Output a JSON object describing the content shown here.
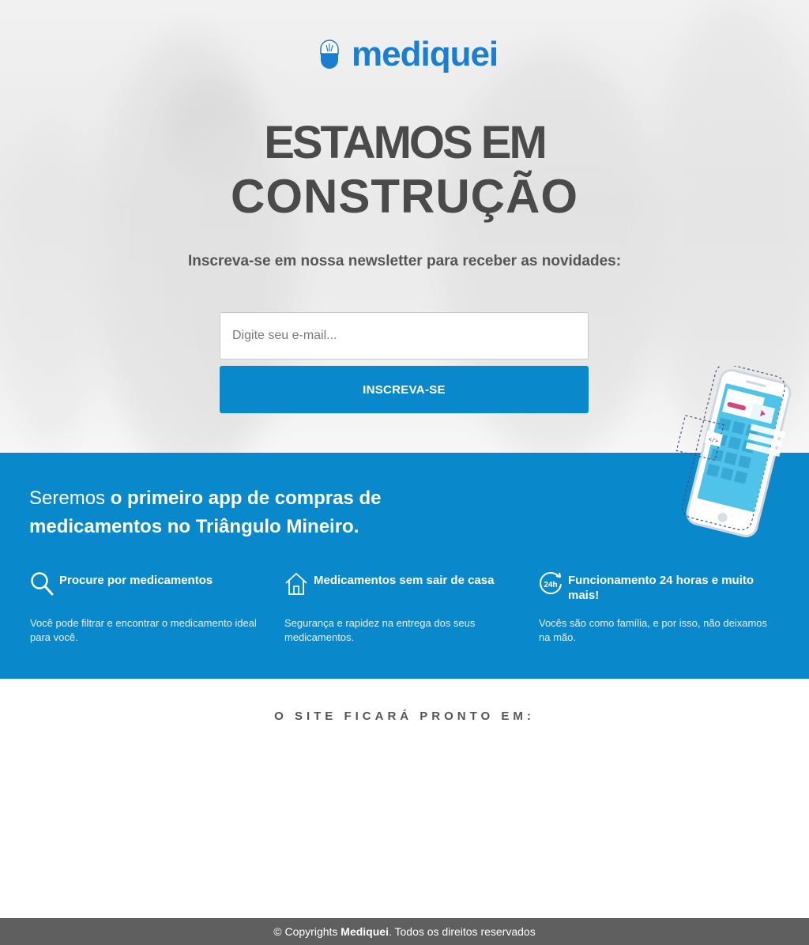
{
  "brand": {
    "name": "mediquei",
    "color": "#1a7fd1"
  },
  "hero": {
    "title_line1": "ESTAMOS EM",
    "title_line2": "CONSTRUÇÃO",
    "subtitle": "Inscreva-se em nossa newsletter para receber as novidades:",
    "email_placeholder": "Digite seu e-mail...",
    "subscribe_label": "INSCREVA-SE"
  },
  "band": {
    "headline_thin": "Seremos ",
    "headline_bold": "o primeiro app de compras de medicamentos no Triângulo Mineiro.",
    "color": "#0a88cc",
    "features": [
      {
        "icon": "search-icon",
        "title": "Procure por medicamentos",
        "desc": "Você pode filtrar e encontrar o medicamento ideal para você."
      },
      {
        "icon": "home-icon",
        "title": "Medicamentos sem sair de casa",
        "desc": "Segurança e rapidez na entrega dos seus medicamentos."
      },
      {
        "icon": "24h-icon",
        "title": "Funcionamento 24 horas e muito mais!",
        "desc": "Vocês são como família, e por isso, não deixamos na mão."
      }
    ]
  },
  "countdown": {
    "label": "O SITE FICARÁ PRONTO EM:"
  },
  "footer": {
    "prefix": "© Copyrights ",
    "brand": "Mediquei",
    "suffix": ". Todos os direitos reservados"
  }
}
